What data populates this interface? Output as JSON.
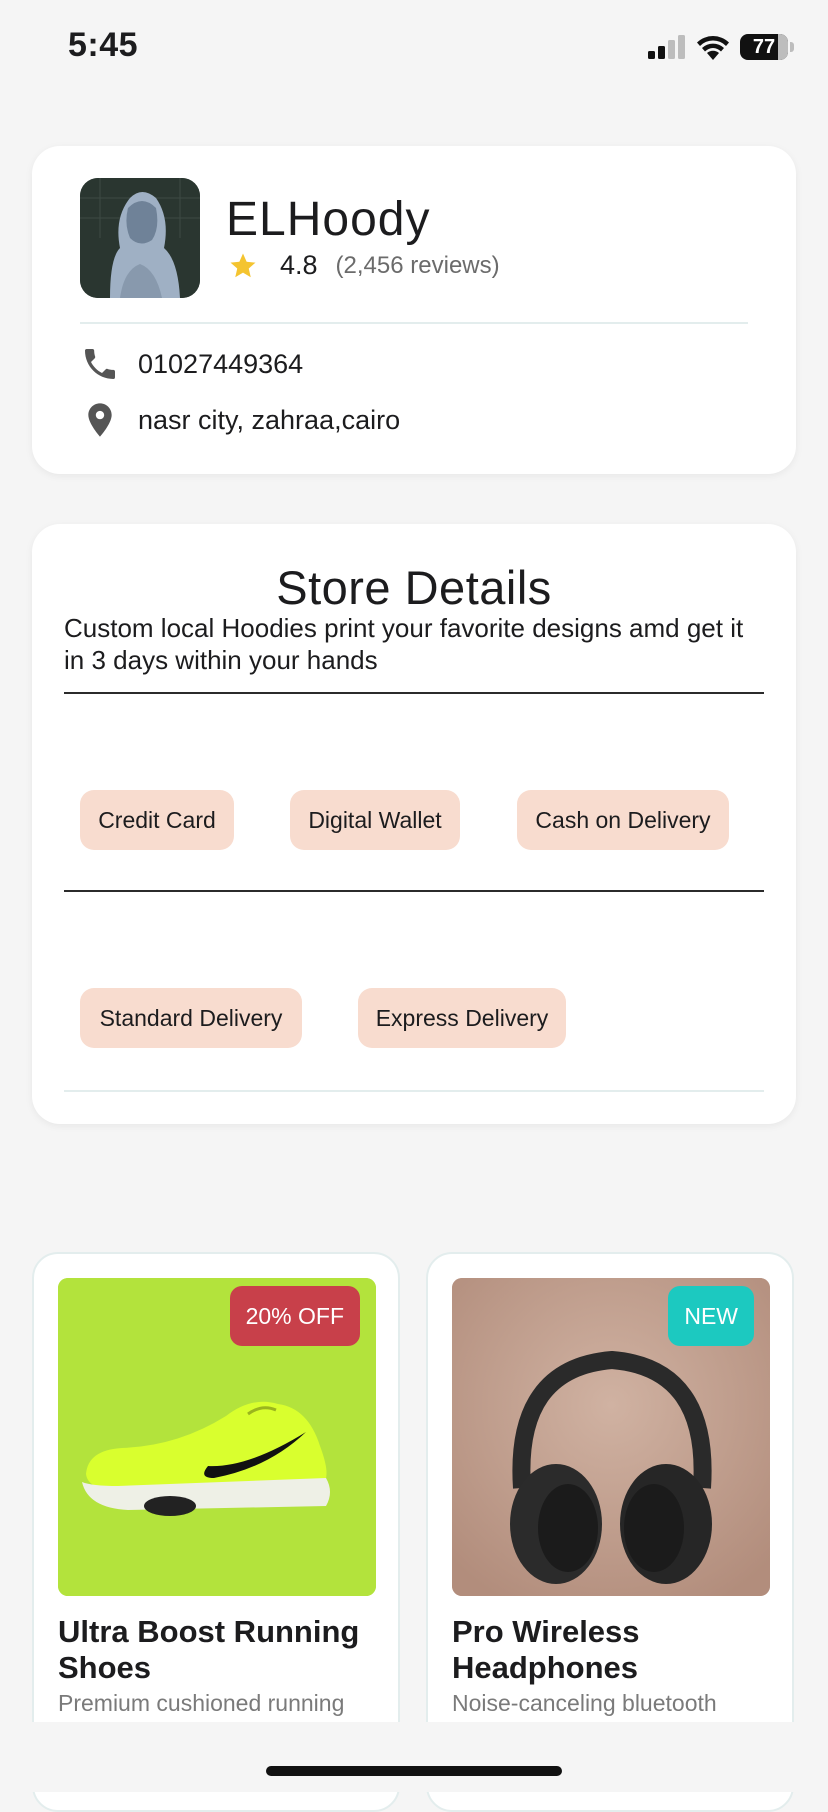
{
  "status_bar": {
    "time": "5:45",
    "battery": "77"
  },
  "store": {
    "name": "ELHoody",
    "rating": "4.8",
    "reviews": "(2,456 reviews)",
    "phone": "01027449364",
    "address": "nasr city, zahraa,cairo"
  },
  "details": {
    "title": "Store Details",
    "description": "Custom local Hoodies  print your favorite designs amd get it in 3 days within your hands",
    "payment_methods": [
      "Credit Card",
      "Digital Wallet",
      "Cash on Delivery"
    ],
    "delivery_options": [
      "Standard Delivery",
      "Express Delivery"
    ]
  },
  "products": [
    {
      "badge": "20% OFF",
      "badge_color": "#c8404a",
      "name": "Ultra Boost Running Shoes",
      "description": "Premium cushioned running shoes",
      "image_bg": "#b3e33c"
    },
    {
      "badge": "NEW",
      "badge_color": "#1cc9c0",
      "name": "Pro Wireless Headphones",
      "description": "Noise-canceling bluetooth headphones",
      "image_bg": "#c4a292"
    }
  ],
  "colors": {
    "star": "#f4c430",
    "chip_bg": "#f8dccf"
  }
}
